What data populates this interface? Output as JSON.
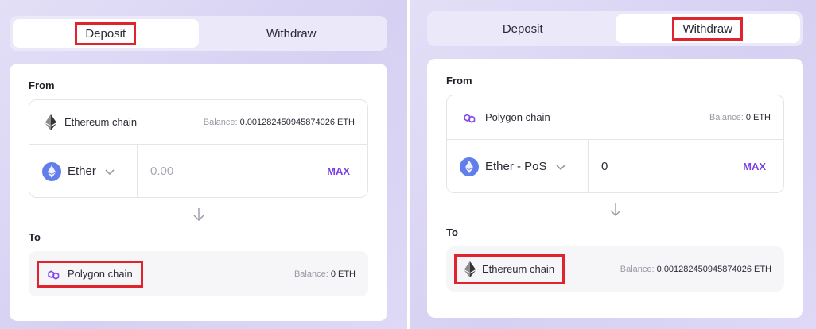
{
  "colors": {
    "accent": "#7b3fe4",
    "highlight": "#e0232d",
    "eth_blue": "#627eea",
    "polygon_purple": "#8247e5"
  },
  "deposit": {
    "tabs": {
      "deposit": "Deposit",
      "withdraw": "Withdraw",
      "active": "deposit"
    },
    "from_label": "From",
    "from_chain": {
      "name": "Ethereum chain",
      "icon": "ethereum-icon",
      "balance_label": "Balance:",
      "balance_value": "0.001282450945874026 ETH"
    },
    "asset": {
      "name": "Ether",
      "icon": "ether-token-icon"
    },
    "amount": {
      "value": "",
      "placeholder": "0.00"
    },
    "max_label": "MAX",
    "to_label": "To",
    "to_chain": {
      "name": "Polygon chain",
      "icon": "polygon-icon",
      "balance_label": "Balance:",
      "balance_value": "0 ETH"
    }
  },
  "withdraw": {
    "tabs": {
      "deposit": "Deposit",
      "withdraw": "Withdraw",
      "active": "withdraw"
    },
    "from_label": "From",
    "from_chain": {
      "name": "Polygon chain",
      "icon": "polygon-icon",
      "balance_label": "Balance:",
      "balance_value": "0 ETH"
    },
    "asset": {
      "name": "Ether - PoS",
      "icon": "ether-token-icon"
    },
    "amount": {
      "value": "0",
      "placeholder": "0.00"
    },
    "max_label": "MAX",
    "to_label": "To",
    "to_chain": {
      "name": "Ethereum chain",
      "icon": "ethereum-icon",
      "balance_label": "Balance:",
      "balance_value": "0.001282450945874026 ETH"
    }
  }
}
